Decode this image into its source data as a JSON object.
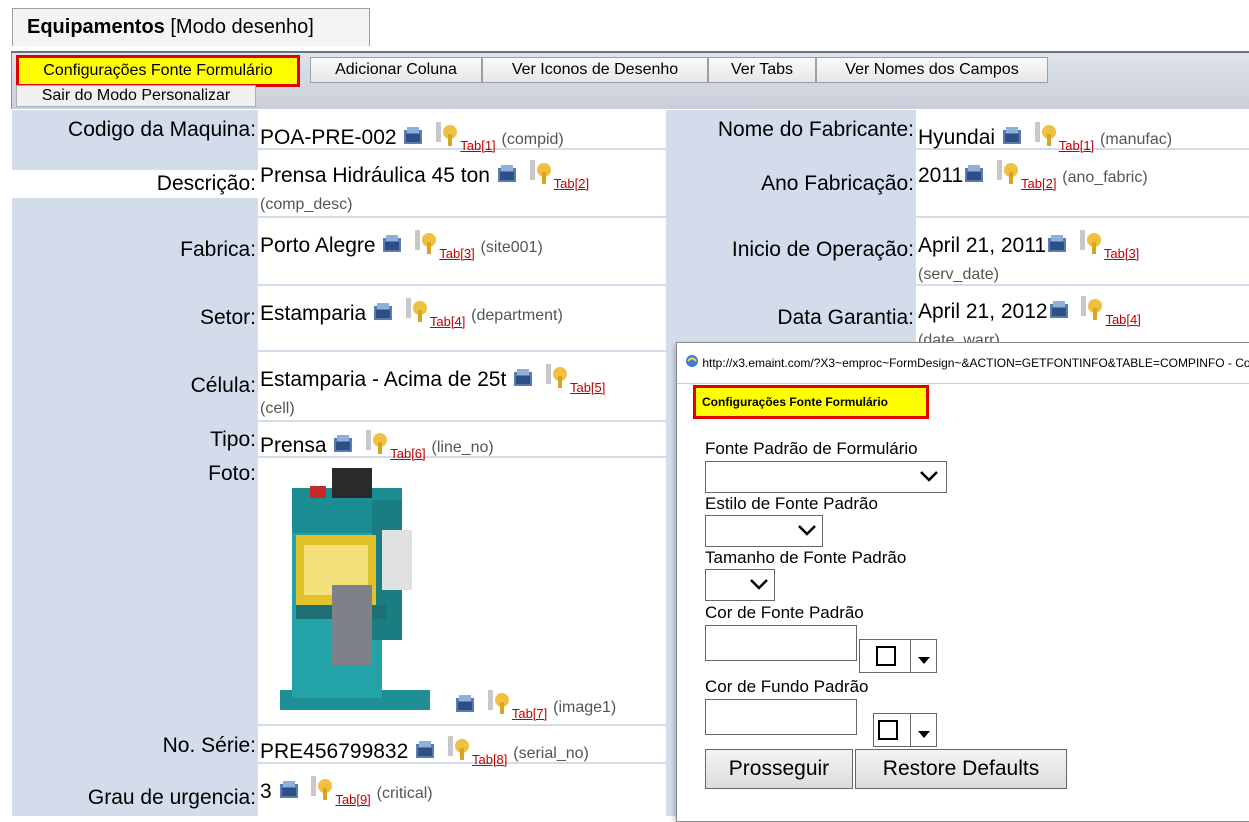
{
  "window": {
    "title_bold": "Equipamentos",
    "title_mode": "[Modo desenho]"
  },
  "toolbar": {
    "config_label": "Configurações Fonte Formulário",
    "add_column_label": "Adicionar Coluna",
    "view_icons_label": "Ver Iconos de Desenho",
    "view_tabs_label": "Ver Tabs",
    "view_names_label": "Ver Nomes dos Campos",
    "exit_label": "Sair do Modo Personalizar"
  },
  "fields": {
    "compid": {
      "label": "Codigo da Maquina:",
      "value": "POA-PRE-002",
      "tab": "Tab[1]",
      "name": "(compid)"
    },
    "comp_desc": {
      "label": "Descrição:",
      "value": "Prensa Hidráulica 45 ton",
      "tab": "Tab[2]",
      "name": "(comp_desc)"
    },
    "site001": {
      "label": "Fabrica:",
      "value": "Porto Alegre",
      "tab": "Tab[3]",
      "name": "(site001)"
    },
    "department": {
      "label": "Setor:",
      "value": "Estamparia",
      "tab": "Tab[4]",
      "name": "(department)"
    },
    "cell": {
      "label": "Célula:",
      "value": "Estamparia - Acima de 25t",
      "tab": "Tab[5]",
      "name": "(cell)"
    },
    "line_no": {
      "label": "Tipo:",
      "value": "Prensa",
      "tab": "Tab[6]",
      "name": "(line_no)"
    },
    "image1": {
      "label": "Foto:",
      "tab": "Tab[7]",
      "name": "(image1)"
    },
    "serial_no": {
      "label": "No. Série:",
      "value": "PRE456799832",
      "tab": "Tab[8]",
      "name": "(serial_no)"
    },
    "critical": {
      "label": "Grau de urgencia:",
      "value": "3",
      "tab": "Tab[9]",
      "name": "(critical)"
    },
    "manufac": {
      "label": "Nome do Fabricante:",
      "value": "Hyundai",
      "tab": "Tab[1]",
      "name": "(manufac)"
    },
    "ano_fabric": {
      "label": "Ano Fabricação:",
      "value": "2011",
      "tab": "Tab[2]",
      "name": "(ano_fabric)"
    },
    "serv_date": {
      "label": "Inicio de Operação:",
      "value": "April 21, 2011",
      "tab": "Tab[3]",
      "name": "(serv_date)"
    },
    "date_warr": {
      "label": "Data Garantia:",
      "value": "April 21, 2012",
      "tab": "Tab[4]",
      "name": "(date_warr)"
    }
  },
  "popup": {
    "url": "http://x3.emaint.com/?X3~emproc~FormDesign~&ACTION=GETFONTINFO&TABLE=COMPINFO - Co",
    "heading": "Configurações Fonte Formulário",
    "font_label": "Fonte Padrão de Formulário",
    "style_label": "Estilo de Fonte Padrão",
    "size_label": "Tamanho de Fonte Padrão",
    "color_label": "Cor de Fonte Padrão",
    "bg_label": "Cor de Fundo Padrão",
    "proceed_label": "Prosseguir",
    "restore_label": "Restore Defaults"
  },
  "colors": {
    "label_bg": "#d2dcea",
    "highlight": "#ffff00",
    "highlight_border": "#e00000",
    "tab_link": "#c00000"
  }
}
